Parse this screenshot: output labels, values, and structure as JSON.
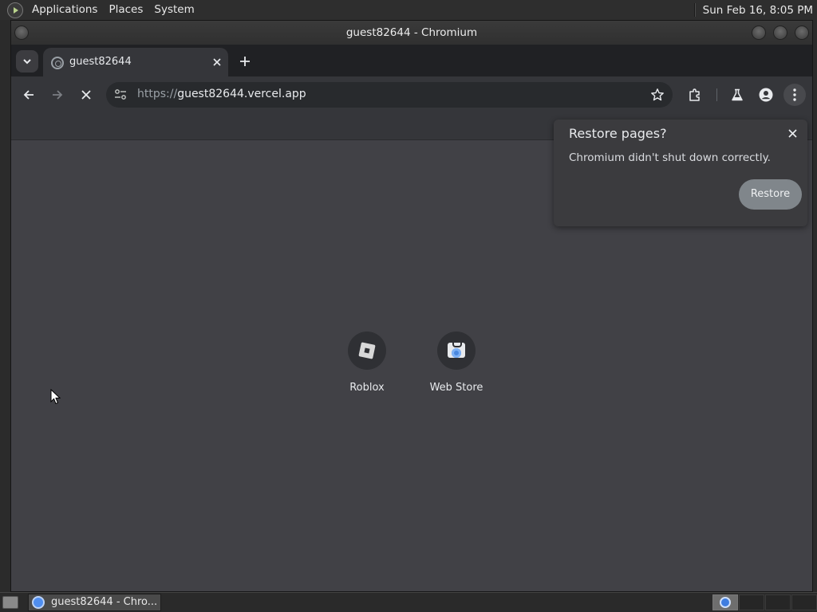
{
  "system_panel": {
    "menus": [
      "Applications",
      "Places",
      "System"
    ],
    "clock": "Sun Feb 16,  8:05 PM"
  },
  "window": {
    "title": "guest82644 - Chromium"
  },
  "tabs": [
    {
      "label": "guest82644",
      "active": true
    }
  ],
  "toolbar": {
    "url_scheme": "https://",
    "url_host": "guest82644.vercel.app"
  },
  "restore_popup": {
    "title": "Restore pages?",
    "message": "Chromium didn't shut down correctly.",
    "button_label": "Restore"
  },
  "shortcuts": [
    {
      "label": "Roblox",
      "icon": "roblox-icon"
    },
    {
      "label": "Web Store",
      "icon": "web-store-icon"
    }
  ],
  "taskbar": {
    "window_button_label": "guest82644 - Chro..."
  },
  "colors": {
    "content_background": "#414146",
    "toolbar_background": "#35363a",
    "tab_strip_background": "#202124",
    "restore_button": "#80868b"
  }
}
